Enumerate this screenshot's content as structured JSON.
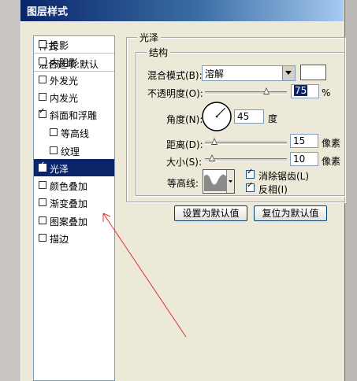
{
  "window": {
    "title": "图层样式"
  },
  "sidebar": {
    "header": "样式",
    "blend_default": "混合选项:默认",
    "items": [
      {
        "label": "投影",
        "checked": false,
        "selected": false
      },
      {
        "label": "内阴影",
        "checked": false,
        "selected": false
      },
      {
        "label": "外发光",
        "checked": false,
        "selected": false
      },
      {
        "label": "内发光",
        "checked": false,
        "selected": false
      },
      {
        "label": "斜面和浮雕",
        "checked": true,
        "selected": false
      },
      {
        "label": "等高线",
        "checked": false,
        "selected": false,
        "sub": true
      },
      {
        "label": "纹理",
        "checked": false,
        "selected": false,
        "sub": true
      },
      {
        "label": "光泽",
        "checked": true,
        "selected": true
      },
      {
        "label": "颜色叠加",
        "checked": false,
        "selected": false
      },
      {
        "label": "渐变叠加",
        "checked": false,
        "selected": false
      },
      {
        "label": "图案叠加",
        "checked": false,
        "selected": false
      },
      {
        "label": "描边",
        "checked": false,
        "selected": false
      }
    ]
  },
  "satin": {
    "group_title": "光泽",
    "structure_title": "结构",
    "blend_mode_label": "混合模式(B):",
    "blend_mode_value": "溶解",
    "opacity_label": "不透明度(O):",
    "opacity_value": "75",
    "opacity_unit": "%",
    "opacity_fraction": 0.75,
    "angle_label": "角度(N):",
    "angle_value": "45",
    "angle_unit": "度",
    "distance_label": "距离(D):",
    "distance_value": "15",
    "distance_unit": "像素",
    "size_label": "大小(S):",
    "size_value": "10",
    "size_unit": "像素",
    "contour_label": "等高线:",
    "anti_alias_label": "消除锯齿(L)",
    "anti_alias_checked": true,
    "invert_label": "反相(I)",
    "invert_checked": true
  },
  "buttons": {
    "make_default": "设置为默认值",
    "reset_default": "复位为默认值"
  },
  "colors": {
    "titlebar_start": "#0a246a",
    "selection": "#0a246a",
    "annotation_arrow": "#e03030"
  }
}
